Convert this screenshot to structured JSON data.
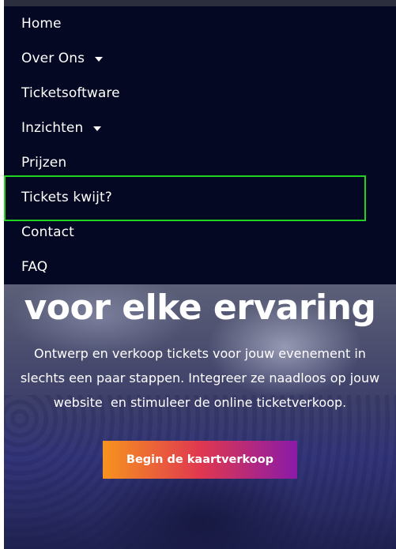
{
  "menu": {
    "items": [
      {
        "label": "Home",
        "has_dropdown": false
      },
      {
        "label": "Over Ons",
        "has_dropdown": true
      },
      {
        "label": "Ticketsoftware",
        "has_dropdown": false
      },
      {
        "label": "Inzichten",
        "has_dropdown": true
      },
      {
        "label": "Prijzen",
        "has_dropdown": false
      },
      {
        "label": "Tickets kwijt?",
        "has_dropdown": false,
        "highlighted": true
      },
      {
        "label": "Contact",
        "has_dropdown": false
      },
      {
        "label": "FAQ",
        "has_dropdown": false
      }
    ],
    "background": "#040822",
    "highlight_color": "#1fd31f"
  },
  "hero": {
    "title": "voor elke ervaring",
    "description_lines": [
      "Ontwerp en verkoop tickets voor jouw evenement in",
      "slechts een paar stappen. Integreer ze naadloos op jouw",
      "website  en stimuleer de online ticketverkoop."
    ],
    "cta_label": "Begin de kaartverkoop",
    "cta_gradient": [
      "#f7931e",
      "#e0384f",
      "#8a1aa8"
    ]
  }
}
